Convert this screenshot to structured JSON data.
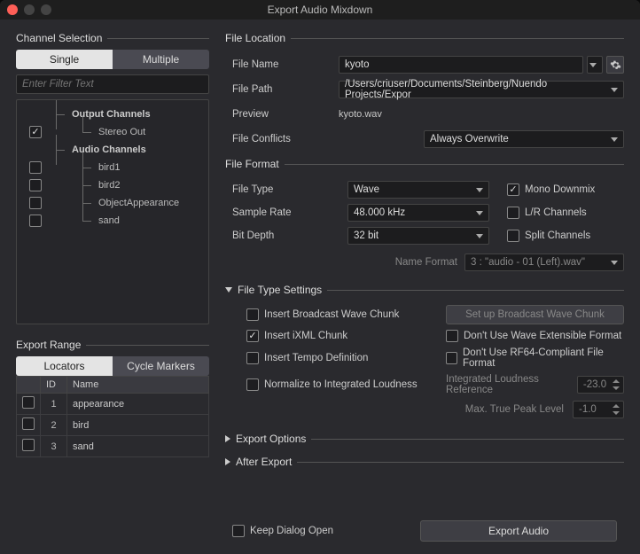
{
  "window_title": "Export Audio Mixdown",
  "channel_selection": {
    "header": "Channel Selection",
    "tabs": {
      "single": "Single",
      "multiple": "Multiple"
    },
    "filter_placeholder": "Enter Filter Text",
    "tree": {
      "output_channels": "Output Channels",
      "stereo_out": "Stereo Out",
      "audio_channels": "Audio Channels",
      "items": [
        "bird1",
        "bird2",
        "ObjectAppearance",
        "sand"
      ]
    }
  },
  "export_range": {
    "header": "Export Range",
    "tabs": {
      "locators": "Locators",
      "cycle": "Cycle Markers"
    },
    "columns": {
      "id": "ID",
      "name": "Name"
    },
    "rows": [
      {
        "id": "1",
        "name": "appearance"
      },
      {
        "id": "2",
        "name": "bird"
      },
      {
        "id": "3",
        "name": "sand"
      }
    ]
  },
  "file_location": {
    "header": "File Location",
    "file_name_label": "File Name",
    "file_name_value": "kyoto",
    "file_path_label": "File Path",
    "file_path_value": "/Users/criuser/Documents/Steinberg/Nuendo Projects/Expor",
    "preview_label": "Preview",
    "preview_value": "kyoto.wav",
    "conflicts_label": "File Conflicts",
    "conflicts_value": "Always Overwrite"
  },
  "file_format": {
    "header": "File Format",
    "file_type_label": "File Type",
    "file_type_value": "Wave",
    "sample_rate_label": "Sample Rate",
    "sample_rate_value": "48.000 kHz",
    "bit_depth_label": "Bit Depth",
    "bit_depth_value": "32 bit",
    "mono_downmix": "Mono Downmix",
    "lr_channels": "L/R Channels",
    "split_channels": "Split Channels",
    "name_format_label": "Name Format",
    "name_format_value": "3 : \"audio - 01 (Left).wav\""
  },
  "file_type_settings": {
    "header": "File Type Settings",
    "insert_bwc": "Insert Broadcast Wave Chunk",
    "setup_bwc": "Set up Broadcast Wave Chunk",
    "insert_ixml": "Insert iXML Chunk",
    "dont_wave_ext": "Don't Use Wave Extensible Format",
    "insert_tempo": "Insert Tempo Definition",
    "dont_rf64": "Don't Use RF64-Compliant File Format",
    "normalize": "Normalize to Integrated Loudness",
    "loudness_ref_label": "Integrated Loudness Reference",
    "loudness_ref_value": "-23.0",
    "max_peak_label": "Max. True Peak Level",
    "max_peak_value": "-1.0"
  },
  "export_options": {
    "header": "Export Options"
  },
  "after_export": {
    "header": "After Export"
  },
  "bottom": {
    "keep_open": "Keep Dialog Open",
    "export": "Export Audio"
  }
}
